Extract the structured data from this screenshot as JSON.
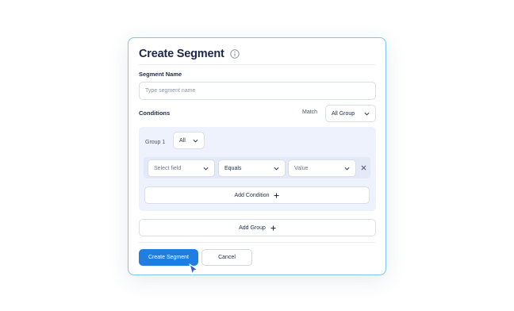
{
  "dialog": {
    "title": "Create Segment",
    "segment_name_label": "Segment Name",
    "segment_name_placeholder": "Type segment name",
    "conditions_label": "Conditions",
    "match_label": "Match",
    "match_value": "All Group",
    "group": {
      "label": "Group 1",
      "logic_value": "All",
      "condition": {
        "field_placeholder": "Select field",
        "operator_value": "Equals",
        "value_placeholder": "Value"
      },
      "add_condition_label": "Add Condition"
    },
    "add_group_label": "Add Group",
    "create_button_label": "Create Segment",
    "cancel_button_label": "Cancel"
  },
  "colors": {
    "primary": "#1e7fe0",
    "dialog_border": "#7cc4f4",
    "group_bg": "#eef2fc",
    "title_text": "#1b2745"
  },
  "icons": [
    "info-icon",
    "chevron-down-icon",
    "close-icon",
    "plus-icon",
    "cursor-pointer-icon"
  ]
}
